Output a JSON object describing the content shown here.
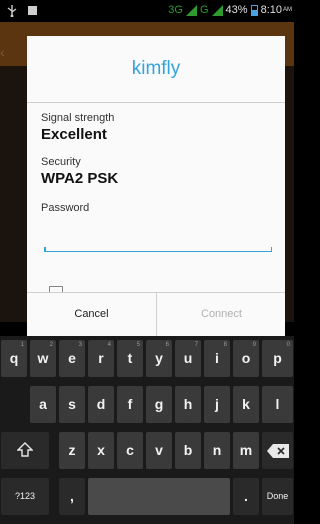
{
  "status_bar": {
    "network": "3G",
    "network2": "G",
    "battery": "43%",
    "time": "8:10",
    "ampm": "AM"
  },
  "dialog": {
    "title": "kimfly",
    "signal_label": "Signal strength",
    "signal_value": "Excellent",
    "security_label": "Security",
    "security_value": "WPA2 PSK",
    "password_label": "Password",
    "password_value": "",
    "cancel_label": "Cancel",
    "connect_label": "Connect"
  },
  "keyboard": {
    "row1": [
      {
        "key": "q",
        "hint": "1"
      },
      {
        "key": "w",
        "hint": "2"
      },
      {
        "key": "e",
        "hint": "3"
      },
      {
        "key": "r",
        "hint": "4"
      },
      {
        "key": "t",
        "hint": "5"
      },
      {
        "key": "y",
        "hint": "6"
      },
      {
        "key": "u",
        "hint": "7"
      },
      {
        "key": "i",
        "hint": "8"
      },
      {
        "key": "o",
        "hint": "9"
      },
      {
        "key": "p",
        "hint": "0"
      }
    ],
    "row2": [
      "a",
      "s",
      "d",
      "f",
      "g",
      "h",
      "j",
      "k",
      "l"
    ],
    "row3": [
      "z",
      "x",
      "c",
      "v",
      "b",
      "n",
      "m"
    ],
    "symbols_label": "?123",
    "comma": ",",
    "period": ".",
    "done_label": "Done"
  },
  "colors": {
    "accent": "#33a3dc",
    "dialog_bg": "#fafafa",
    "key_bg": "#3a3a3a",
    "keyboard_bg": "#1a1a1a"
  }
}
